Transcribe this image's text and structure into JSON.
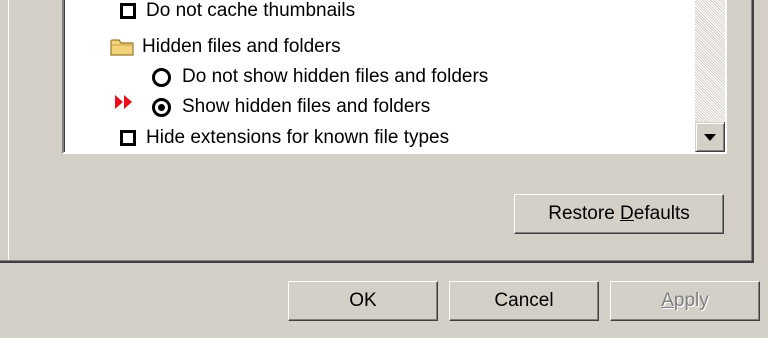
{
  "list": {
    "items": [
      {
        "type": "checkbox",
        "label": "Do not cache thumbnails",
        "checked": false
      },
      {
        "type": "folder",
        "icon": "folder-icon",
        "label": "Hidden files and folders"
      },
      {
        "type": "radio",
        "label": "Do not show hidden files and folders",
        "selected": false
      },
      {
        "type": "radio",
        "label": "Show hidden files and folders",
        "selected": true
      },
      {
        "type": "checkbox",
        "label": "Hide extensions for known file types",
        "checked": false
      }
    ]
  },
  "restore_defaults": {
    "prefix": "Restore ",
    "accel": "D",
    "suffix": "efaults"
  },
  "buttons": {
    "ok": "OK",
    "cancel": "Cancel",
    "apply": {
      "accel": "A",
      "suffix": "pply",
      "disabled": true
    }
  },
  "colors": {
    "arrow": "#e8101a",
    "folder": "#f2d27a",
    "face": "#d4d0c8"
  }
}
